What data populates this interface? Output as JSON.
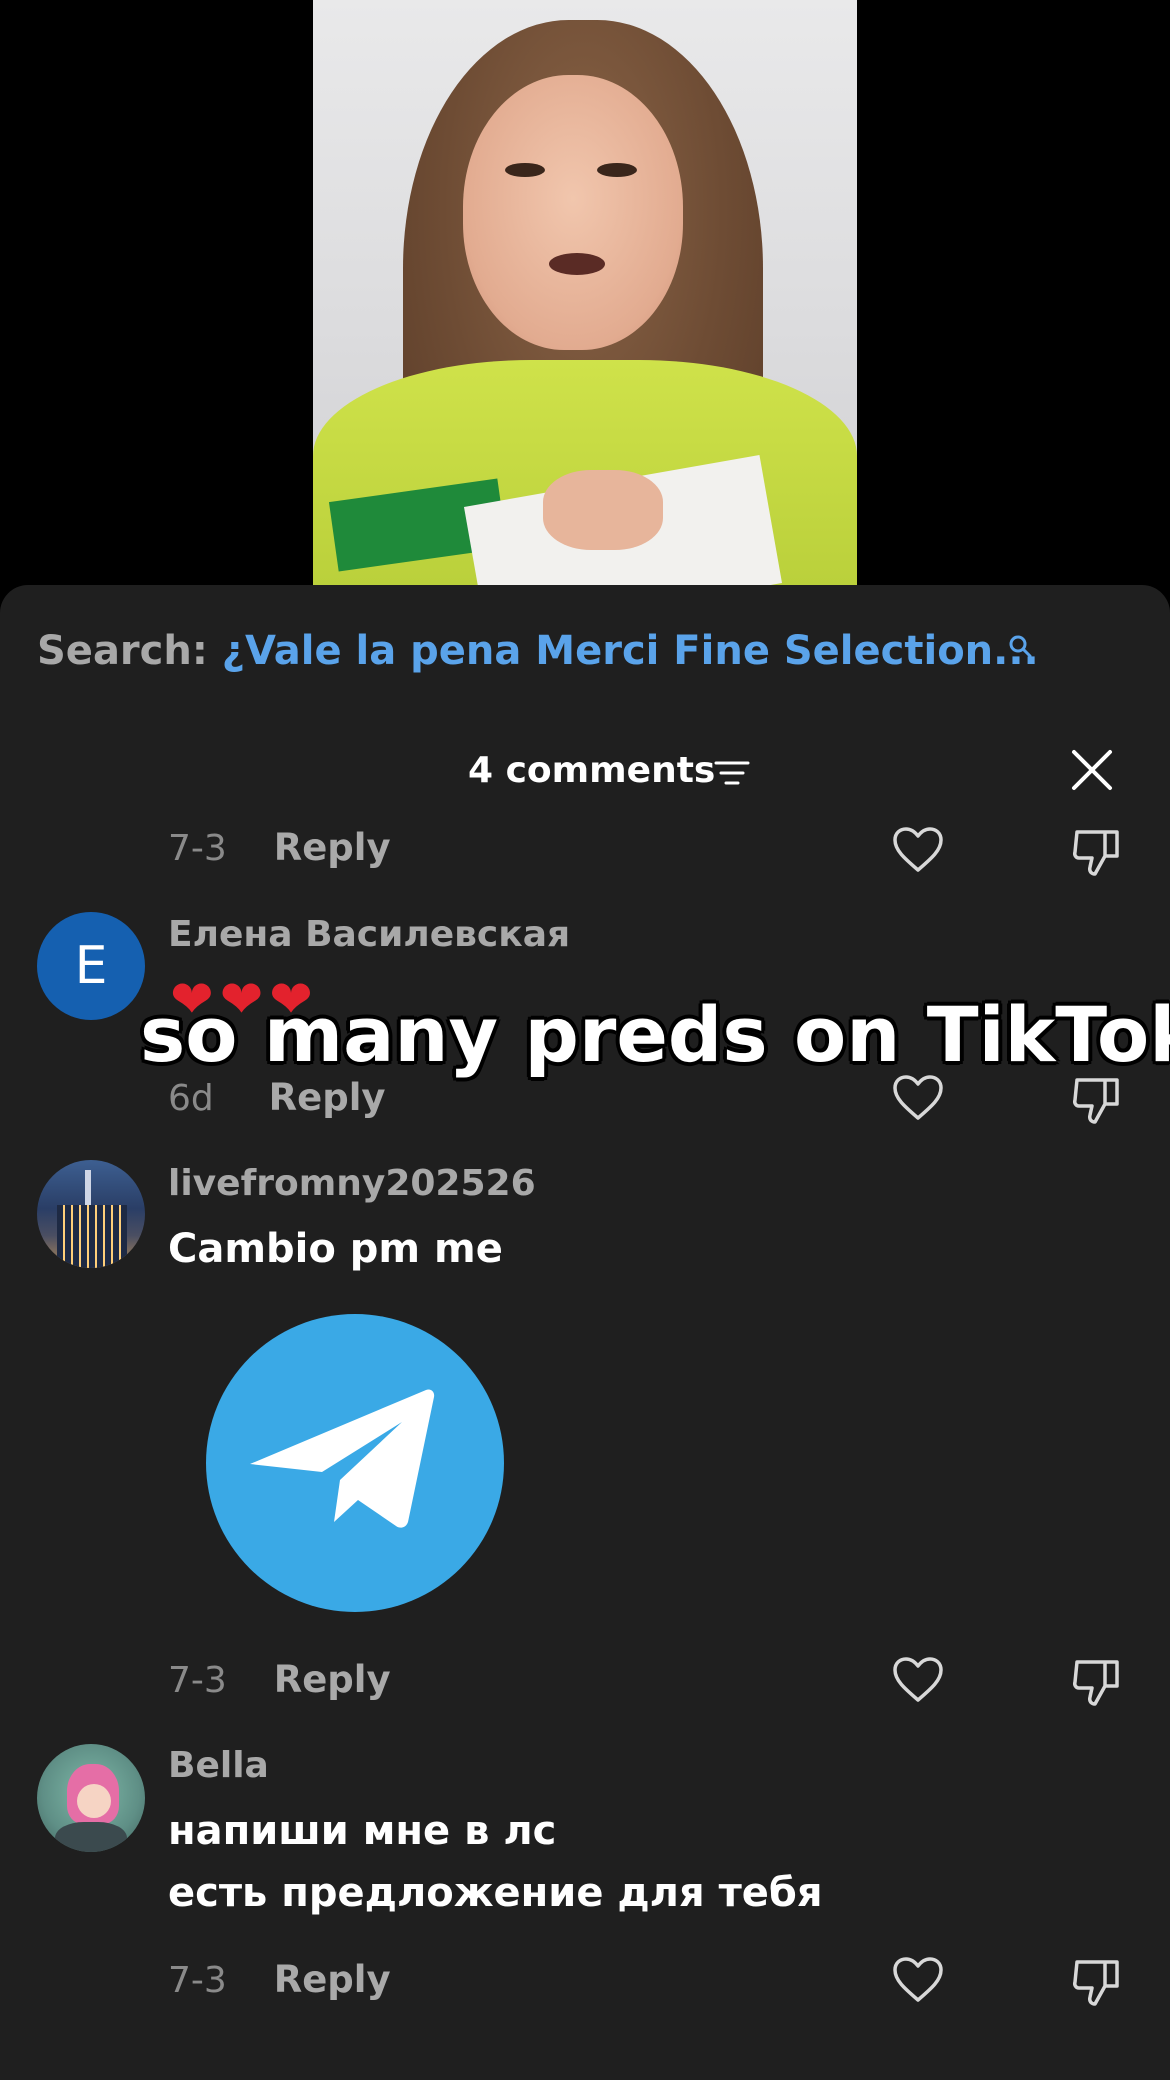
{
  "search": {
    "label": "Search:",
    "query": "¿Vale la pena Merci Fine Selection..."
  },
  "header": {
    "title": "4 comments"
  },
  "overlay": {
    "caption": "so many preds on TikTok"
  },
  "comments": [
    {
      "date": "7-3",
      "reply_label": "Reply"
    },
    {
      "avatar_letter": "E",
      "username": "Елена Василевская",
      "text": "❤❤❤",
      "date": "6d",
      "reply_label": "Reply"
    },
    {
      "username": "livefromny202526",
      "text": "Cambio pm me",
      "date": "7-3",
      "reply_label": "Reply"
    },
    {
      "username": "Bella",
      "text_line1": "напиши мне в лс",
      "text_line2": "есть предложение для тебя",
      "date": "7-3",
      "reply_label": "Reply"
    }
  ],
  "colors": {
    "sheet_bg": "#1f1f1f",
    "search_query": "#5aa3ea",
    "avatar_e": "#1560b0",
    "telegram": "#3aa9e6"
  }
}
